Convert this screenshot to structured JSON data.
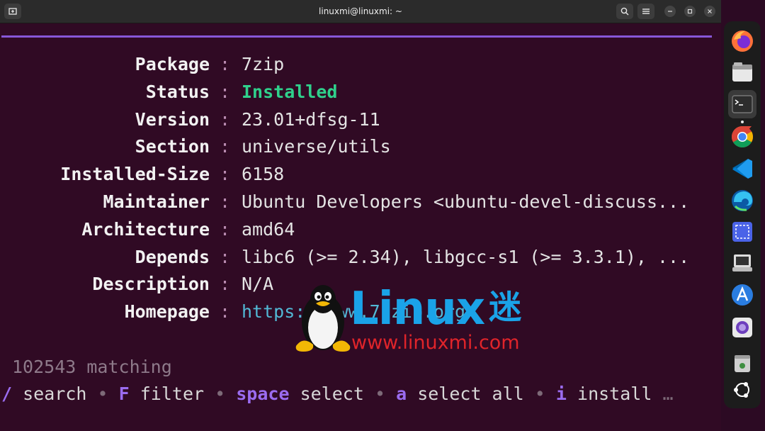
{
  "window": {
    "title": "linuxmi@linuxmi: ~",
    "controls": [
      "minimize",
      "maximize",
      "close"
    ]
  },
  "package_info": [
    {
      "key": "Package",
      "value": "7zip"
    },
    {
      "key": "Status",
      "value": "Installed"
    },
    {
      "key": "Version",
      "value": "23.01+dfsg-11"
    },
    {
      "key": "Section",
      "value": "universe/utils"
    },
    {
      "key": "Installed-Size",
      "value": "6158"
    },
    {
      "key": "Maintainer",
      "value": "Ubuntu Developers <ubuntu-devel-discuss..."
    },
    {
      "key": "Architecture",
      "value": "amd64"
    },
    {
      "key": "Depends",
      "value": "libc6 (>= 2.34), libgcc-s1 (>= 3.3.1), ..."
    },
    {
      "key": "Description",
      "value": "N/A"
    },
    {
      "key": "Homepage",
      "value": "https://www.7-zip.org"
    }
  ],
  "separator": ":",
  "status": {
    "matching": "102543 matching"
  },
  "help": [
    {
      "key": "/",
      "desc": "search"
    },
    {
      "key": "F",
      "desc": "filter"
    },
    {
      "key": "space",
      "desc": "select"
    },
    {
      "key": "a",
      "desc": "select all"
    },
    {
      "key": "i",
      "desc": "install"
    }
  ],
  "help_bullet": "•",
  "help_more": "…",
  "watermark": {
    "word": "Linux",
    "char": "迷",
    "url": "www.linuxmi.com"
  },
  "dock": [
    "firefox-icon",
    "files-icon",
    "terminal-icon",
    "chrome-icon",
    "vscode-icon",
    "edge-icon",
    "screenshot-icon",
    "software-icon",
    "app-store-icon",
    "camera-icon",
    "trash-icon",
    "ubuntu-icon"
  ],
  "colors": {
    "accent": "#8757d7",
    "installed": "#2fd18c",
    "link": "#52b9d6",
    "background": "#300a24"
  }
}
